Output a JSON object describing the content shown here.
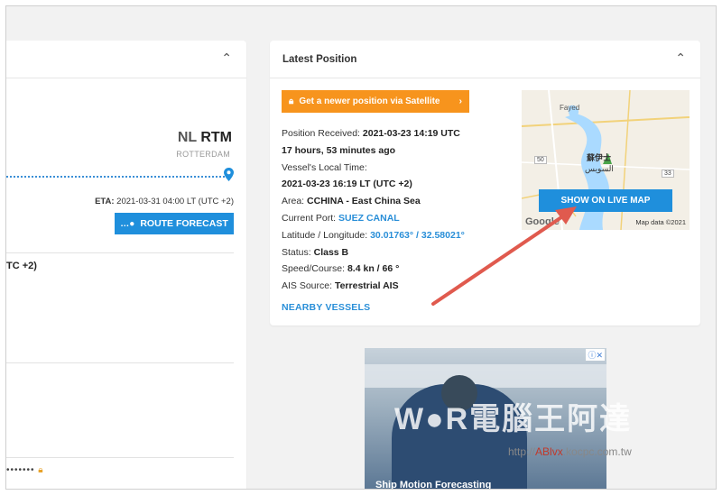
{
  "left_panel": {
    "port_country": "NL",
    "port_code": "RTM",
    "port_name": "ROTTERDAM",
    "eta_label": "ETA:",
    "eta_value": "2021-03-31 04:00 LT (UTC +2)",
    "route_button": "ROUTE FORECAST",
    "utc_fragment": "TC +2)",
    "dots": "•••••••"
  },
  "latest_position": {
    "title": "Latest Position",
    "satellite_button": "Get a newer position via Satellite",
    "position_received_label": "Position Received:",
    "position_received_value": "2021-03-23 14:19 UTC",
    "position_age": "17 hours, 53 minutes ago",
    "local_time_label": "Vessel's Local Time:",
    "local_time_value": "2021-03-23 16:19 LT (UTC +2)",
    "area_label": "Area:",
    "area_value": "CCHINA - East China Sea",
    "current_port_label": "Current Port:",
    "current_port_value": "SUEZ CANAL",
    "latlon_label": "Latitude / Longitude:",
    "latitude": "30.01763°",
    "longitude": "32.58021°",
    "status_label": "Status:",
    "status_value": "Class B",
    "speed_label": "Speed/Course:",
    "speed_value": "8.4 kn / 66 °",
    "ais_label": "AIS Source:",
    "ais_value": "Terrestrial AIS",
    "nearby_link": "NEARBY VESSELS"
  },
  "map": {
    "label_fayed": "Fayed",
    "label_cn": "蘇伊士",
    "label_ar": "السويس",
    "road_50": "50",
    "road_33": "33",
    "live_map_button": "SHOW ON LIVE MAP",
    "google": "Google",
    "map_data": "Map data ©2021"
  },
  "ad": {
    "title": "Ship Motion Forecasting"
  },
  "watermark": {
    "text": "W●R電腦王阿達",
    "url_pre": "http://",
    "url_mid": "ABlvx",
    "url_post": ".kocpc.com.tw"
  },
  "colors": {
    "accent_blue": "#1f8fdc",
    "orange": "#f7941d",
    "annotation_red": "#e05a4e"
  }
}
